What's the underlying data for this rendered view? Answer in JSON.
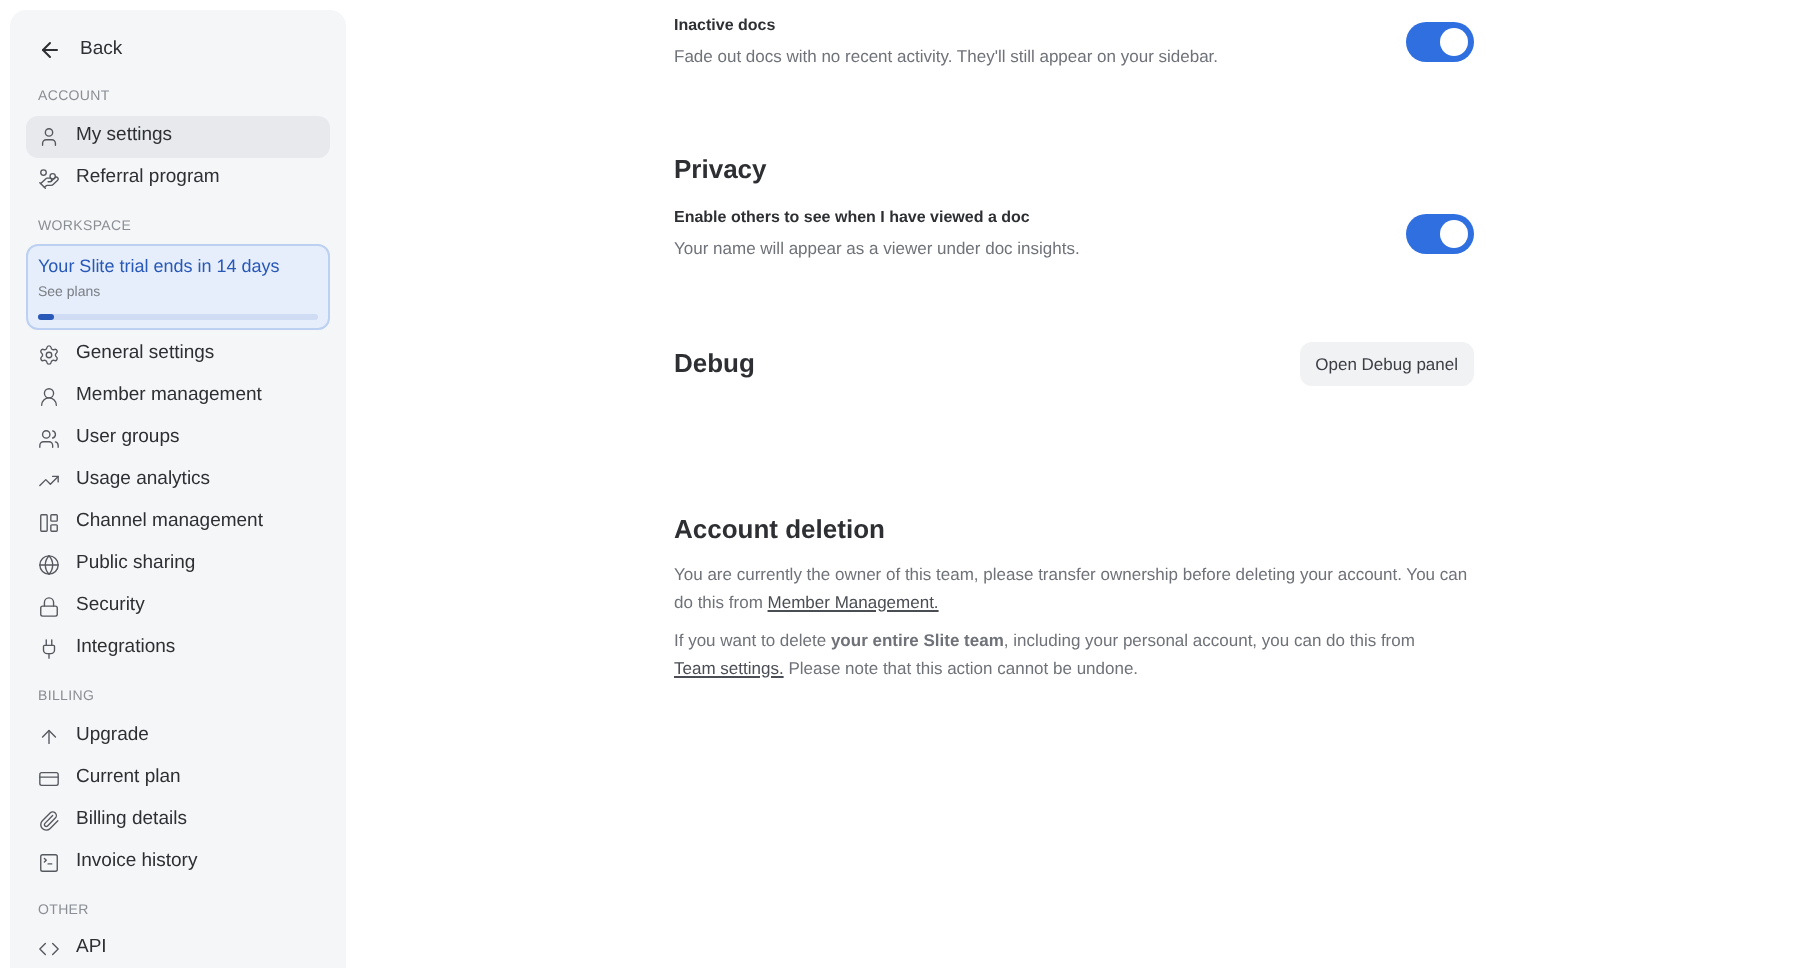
{
  "sidebar": {
    "back": "Back",
    "sections": [
      {
        "title": "ACCOUNT",
        "items": [
          {
            "label": "My settings",
            "selected": true
          },
          {
            "label": "Referral program",
            "selected": false
          }
        ]
      },
      {
        "title": "WORKSPACE",
        "trial": {
          "title": "Your Slite trial ends in 14 days",
          "link": "See plans",
          "level": 0.06
        },
        "items": [
          {
            "label": "General settings",
            "selected": false
          },
          {
            "label": "Member management",
            "selected": false
          },
          {
            "label": "User groups",
            "selected": false
          },
          {
            "label": "Usage analytics",
            "selected": false
          },
          {
            "label": "Channel management",
            "selected": false
          },
          {
            "label": "Public sharing",
            "selected": false
          },
          {
            "label": "Security",
            "selected": false
          },
          {
            "label": "Integrations",
            "selected": false
          }
        ]
      },
      {
        "title": "BILLING",
        "items": [
          {
            "label": "Upgrade",
            "selected": false
          },
          {
            "label": "Current plan",
            "selected": false
          },
          {
            "label": "Billing details",
            "selected": false
          },
          {
            "label": "Invoice history",
            "selected": false
          }
        ]
      },
      {
        "title": "OTHER",
        "items": [
          {
            "label": "API",
            "selected": false
          }
        ]
      }
    ]
  },
  "main": {
    "inactive_docs": {
      "title": "Inactive docs",
      "description": "Fade out docs with no recent activity. They'll still appear on your sidebar.",
      "on": true
    },
    "privacy": {
      "heading": "Privacy",
      "title": "Enable others to see when I have viewed a doc",
      "description": "Your name will appear as a viewer under doc insights.",
      "on": true
    },
    "debug": {
      "heading": "Debug",
      "button": "Open Debug panel"
    },
    "account_deletion": {
      "heading": "Account deletion",
      "paragraphs": [
        {
          "before": "You are currently the owner of this team, please transfer ownership before deleting your account. You can do this from",
          "link": "Member Management."
        },
        {
          "before": "If you want to delete **your entire Slite team**, including your personal account, you can do this from",
          "link": "Team settings.",
          "after": "Please note that this action cannot be undone."
        }
      ]
    }
  }
}
